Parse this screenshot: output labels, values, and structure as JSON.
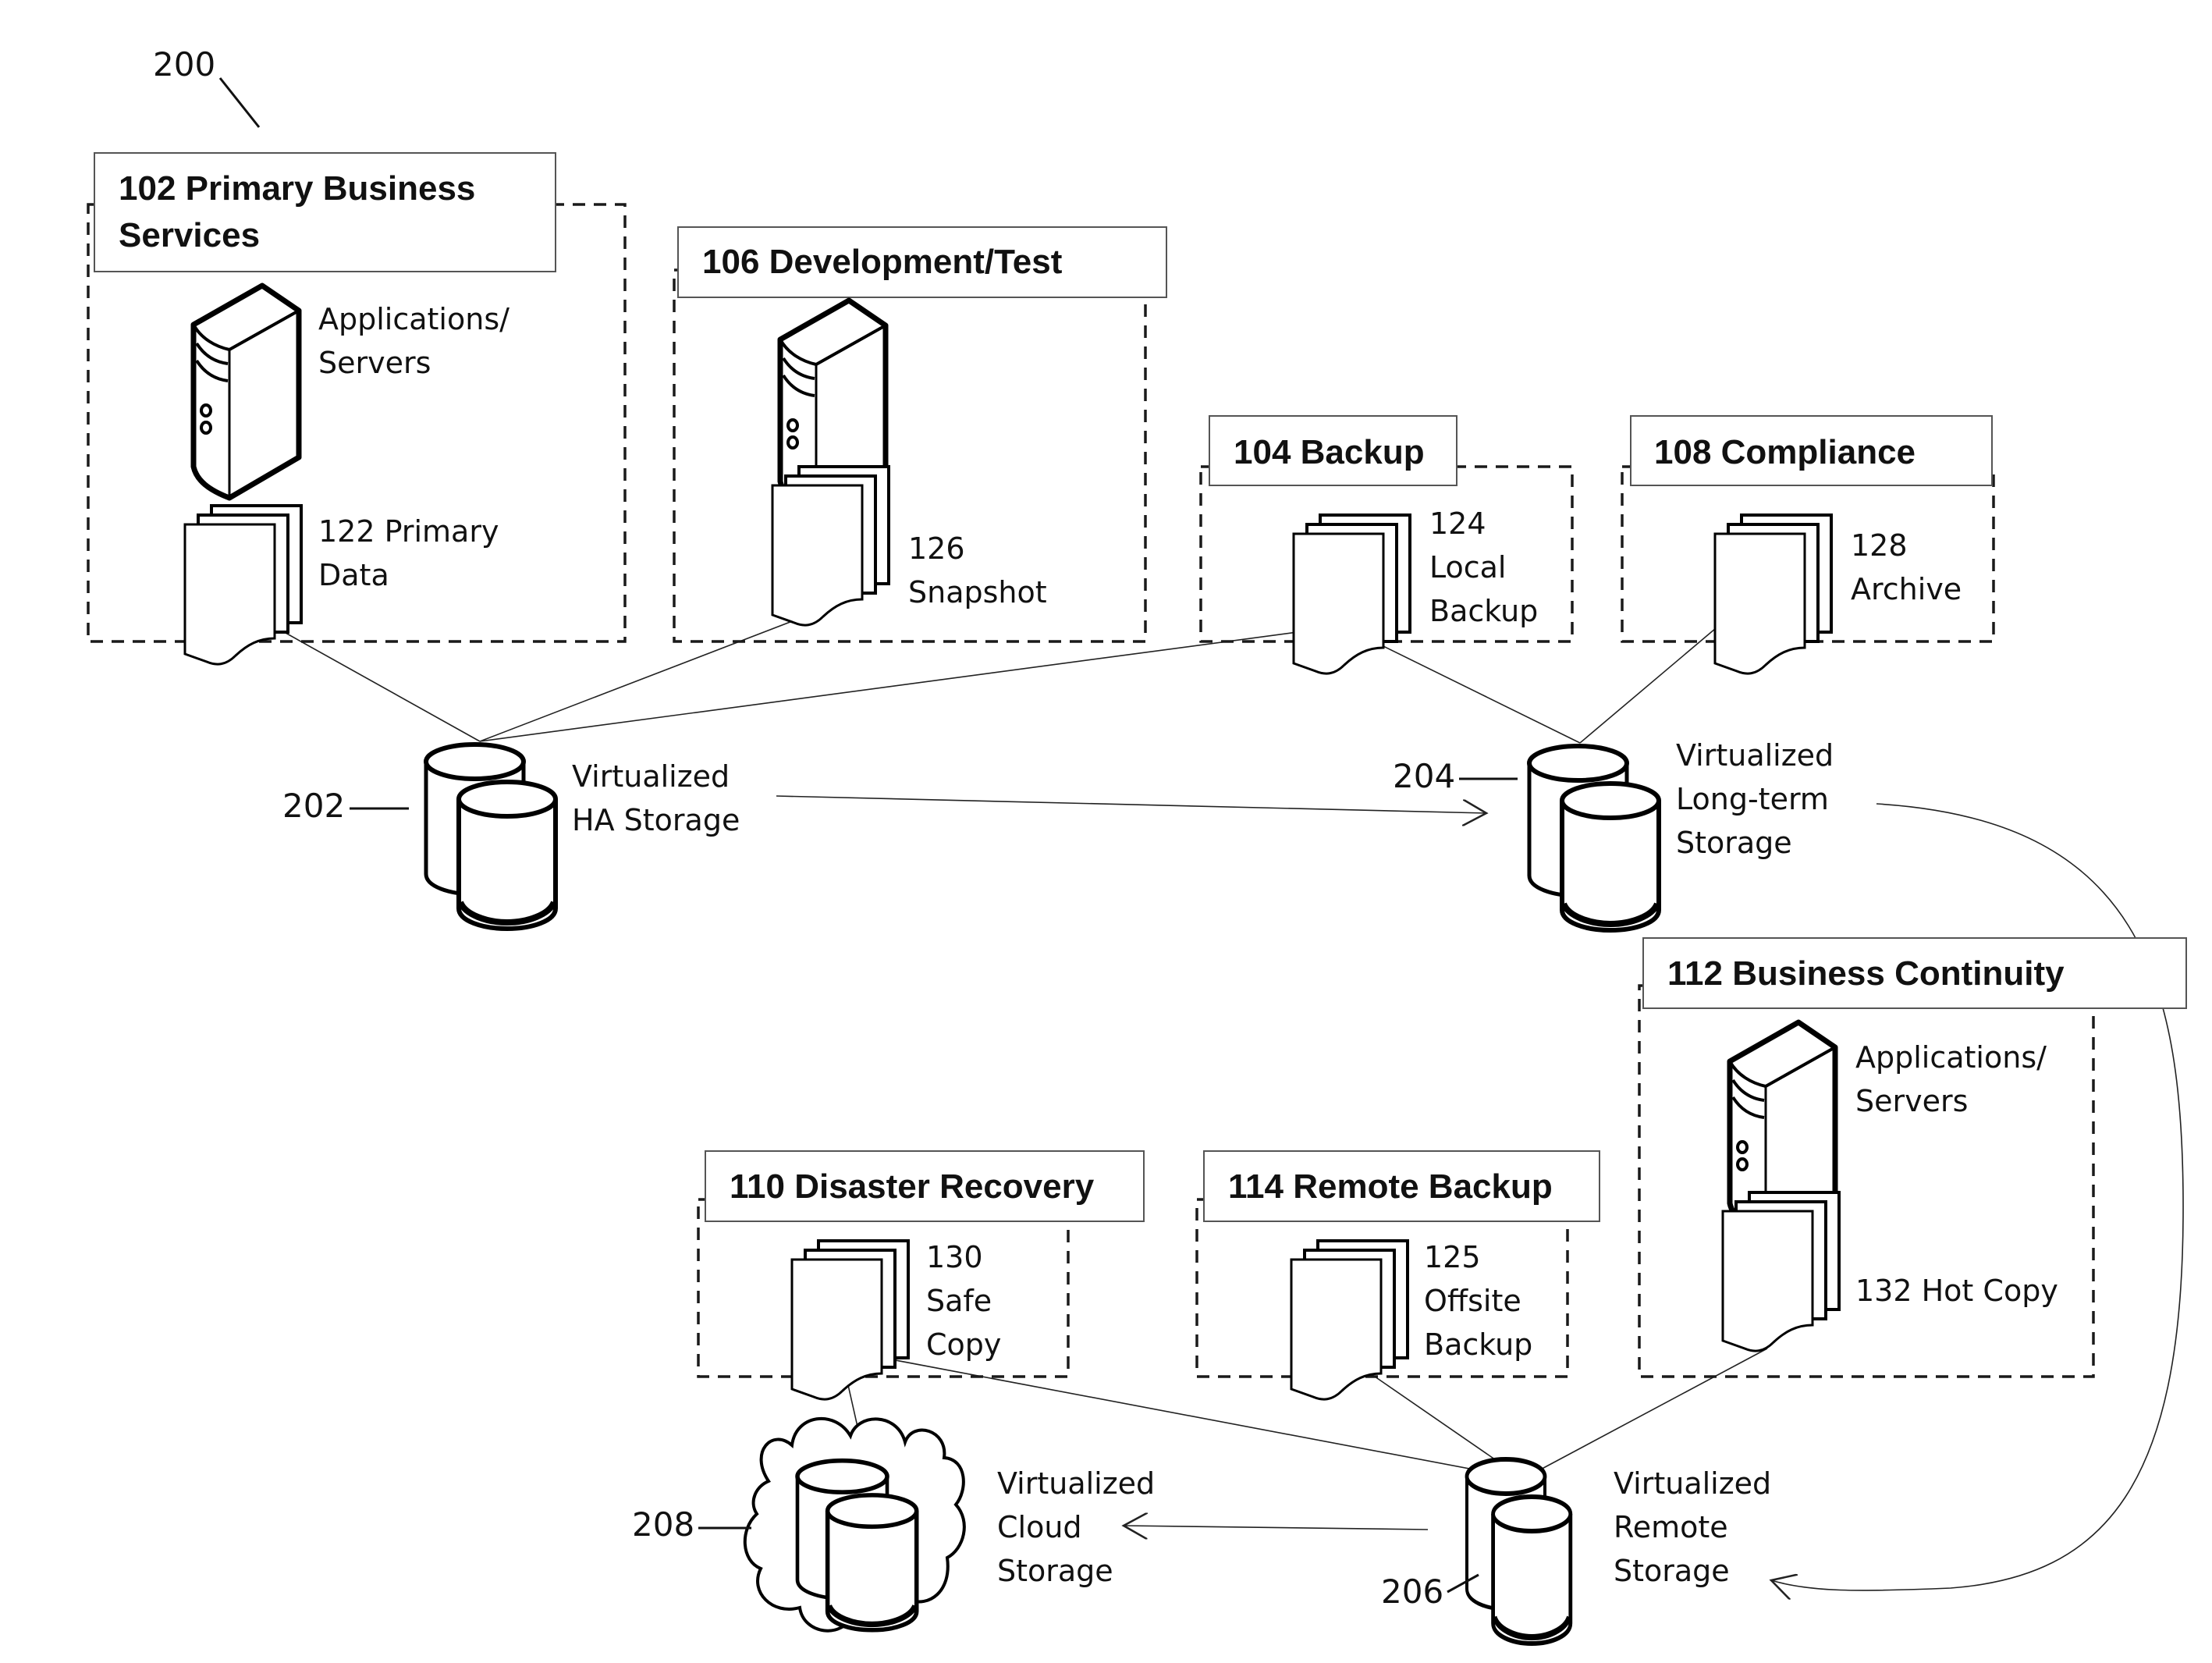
{
  "figure": {
    "ref": "200"
  },
  "groups": [
    {
      "id": "102",
      "title_lines": [
        "102 Primary Business",
        "Services"
      ],
      "server_label_lines": [
        "Applications/",
        "Servers"
      ],
      "data_label_lines": [
        "122 Primary",
        "Data"
      ]
    },
    {
      "id": "106",
      "title_lines": [
        "106 Development/Test"
      ],
      "data_label_lines": [
        "126",
        "Snapshot"
      ]
    },
    {
      "id": "104",
      "title_lines": [
        "104 Backup"
      ],
      "data_label_lines": [
        "124",
        "Local",
        "Backup"
      ]
    },
    {
      "id": "108",
      "title_lines": [
        "108 Compliance"
      ],
      "data_label_lines": [
        "128",
        "Archive"
      ]
    },
    {
      "id": "112",
      "title_lines": [
        "112 Business Continuity"
      ],
      "server_label_lines": [
        "Applications/",
        "Servers"
      ],
      "data_label_lines": [
        "132 Hot Copy"
      ]
    },
    {
      "id": "110",
      "title_lines": [
        "110 Disaster Recovery"
      ],
      "data_label_lines": [
        "130",
        "Safe",
        "Copy"
      ]
    },
    {
      "id": "114",
      "title_lines": [
        "114 Remote Backup"
      ],
      "data_label_lines": [
        "125",
        "Offsite",
        "Backup"
      ]
    }
  ],
  "storage": [
    {
      "ref": "202",
      "label_lines": [
        "Virtualized",
        "HA Storage"
      ],
      "icon": "database-icon"
    },
    {
      "ref": "204",
      "label_lines": [
        "Virtualized",
        "Long-term",
        "Storage"
      ],
      "icon": "database-icon"
    },
    {
      "ref": "206",
      "label_lines": [
        "Virtualized",
        "Remote",
        "Storage"
      ],
      "icon": "database-icon"
    },
    {
      "ref": "208",
      "label_lines": [
        "Virtualized",
        "Cloud",
        "Storage"
      ],
      "icon": "cloud-database-icon"
    }
  ]
}
